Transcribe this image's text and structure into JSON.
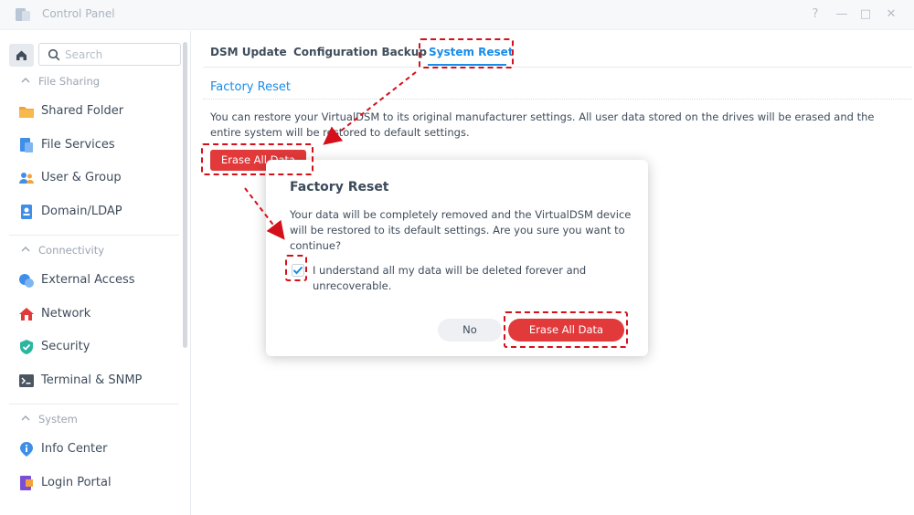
{
  "window": {
    "title": "Control Panel",
    "controls": [
      "?",
      "—",
      "□",
      "✕"
    ]
  },
  "sidebar": {
    "search_placeholder": "Search",
    "sections": [
      {
        "label": "File Sharing",
        "items": [
          {
            "label": "Shared Folder",
            "icon": "folder-icon"
          },
          {
            "label": "File Services",
            "icon": "file-services-icon"
          },
          {
            "label": "User & Group",
            "icon": "user-group-icon"
          },
          {
            "label": "Domain/LDAP",
            "icon": "domain-ldap-icon"
          }
        ]
      },
      {
        "label": "Connectivity",
        "items": [
          {
            "label": "External Access",
            "icon": "external-access-icon"
          },
          {
            "label": "Network",
            "icon": "network-icon"
          },
          {
            "label": "Security",
            "icon": "shield-icon"
          },
          {
            "label": "Terminal & SNMP",
            "icon": "terminal-icon"
          }
        ]
      },
      {
        "label": "System",
        "items": [
          {
            "label": "Info Center",
            "icon": "info-icon"
          },
          {
            "label": "Login Portal",
            "icon": "login-portal-icon"
          }
        ]
      }
    ]
  },
  "tabs": [
    {
      "label": "DSM Update",
      "active": false
    },
    {
      "label": "Configuration Backup",
      "active": false
    },
    {
      "label": "System Reset",
      "active": true
    }
  ],
  "main": {
    "section_title": "Factory Reset",
    "description": "You can restore your VirtualDSM to its original manufacturer settings. All user data stored on the drives will be erased and the entire system will be restored to default settings.",
    "erase_button": "Erase All Data"
  },
  "dialog": {
    "title": "Factory Reset",
    "message": "Your data will be completely removed and the VirtualDSM device will be restored to its default settings. Are you sure you want to continue?",
    "checkbox_label": "I understand all my data will be deleted forever and unrecoverable.",
    "checkbox_checked": true,
    "no_button": "No",
    "confirm_button": "Erase All Data"
  },
  "colors": {
    "accent": "#1a8ce8",
    "danger": "#e2393b",
    "annotation": "#d4101a"
  }
}
